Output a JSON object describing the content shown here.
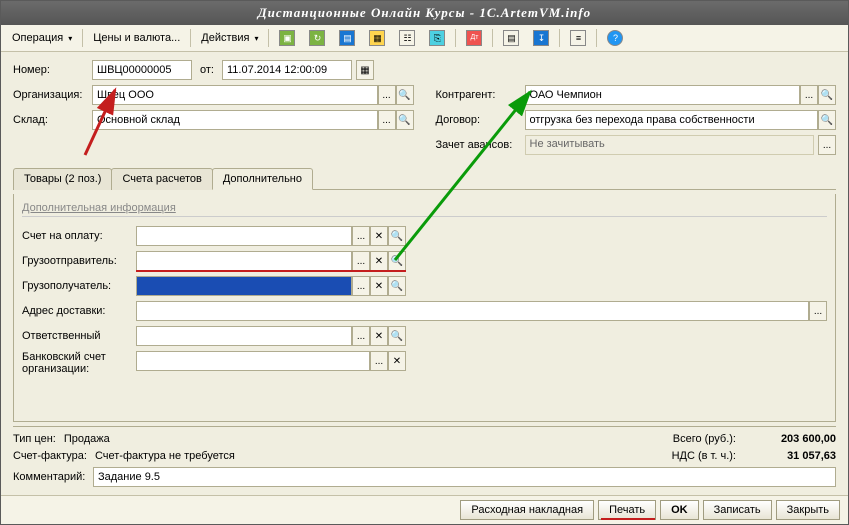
{
  "title": "Дистанционные Онлайн Курсы - 1C.ArtemVM.info",
  "toolbar": {
    "operation": "Операция",
    "prices": "Цены и валюта...",
    "actions": "Действия"
  },
  "header": {
    "number_lbl": "Номер:",
    "number": "ШВЦ00000005",
    "from_lbl": "от:",
    "date": "11.07.2014 12:00:09",
    "org_lbl": "Организация:",
    "org": "Швец ООО",
    "warehouse_lbl": "Склад:",
    "warehouse": "Основной склад",
    "contragent_lbl": "Контрагент:",
    "contragent": "ОАО Чемпион",
    "contract_lbl": "Договор:",
    "contract": "отгрузка без перехода права собственности",
    "advance_lbl": "Зачет авансов:",
    "advance": "Не зачитывать"
  },
  "tabs": {
    "goods": "Товары (2 поз.)",
    "accounts": "Счета расчетов",
    "extra": "Дополнительно"
  },
  "extra": {
    "group_title": "Дополнительная информация",
    "invoice_lbl": "Счет на оплату:",
    "shipper_lbl": "Грузоотправитель:",
    "consignee_lbl": "Грузополучатель:",
    "address_lbl": "Адрес доставки:",
    "responsible_lbl": "Ответственный",
    "bank_lbl": "Банковский счет организации:"
  },
  "summary": {
    "price_type_lbl": "Тип цен:",
    "price_type": "Продажа",
    "invoice_fact_lbl": "Счет-фактура:",
    "invoice_fact": "Счет-фактура не требуется",
    "comment_lbl": "Комментарий:",
    "comment": "Задание 9.5",
    "total_lbl": "Всего (руб.):",
    "total": "203 600,00",
    "vat_lbl": "НДС (в т. ч.):",
    "vat": "31 057,63"
  },
  "footer": {
    "invoice_out": "Расходная накладная",
    "print": "Печать",
    "ok": "OK",
    "save": "Записать",
    "close": "Закрыть"
  }
}
